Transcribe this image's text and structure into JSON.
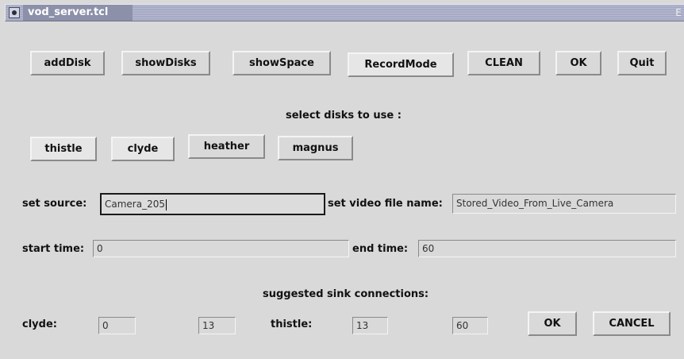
{
  "window": {
    "title": "vod_server.tcl",
    "corner_glyph": "E"
  },
  "toolbar": {
    "buttons": [
      "addDisk",
      "showDisks",
      "showSpace",
      "RecordMode",
      "CLEAN",
      "OK",
      "Quit"
    ]
  },
  "disks": {
    "heading": "select disks to use :",
    "items": [
      "thistle",
      "clyde",
      "heather",
      "magnus"
    ]
  },
  "source": {
    "label": "set source:",
    "value": "Camera_205",
    "file_label": "set video file name:",
    "file_value": "Stored_Video_From_Live_Camera"
  },
  "time": {
    "start_label": "start time:",
    "start_value": "0",
    "end_label": "end time:",
    "end_value": "60"
  },
  "sink": {
    "heading": "suggested sink connections:",
    "clyde_label": "clyde:",
    "clyde_from": "0",
    "clyde_to": "13",
    "thistle_label": "thistle:",
    "thistle_from": "13",
    "thistle_to": "60",
    "ok_label": "OK",
    "cancel_label": "CANCEL"
  }
}
